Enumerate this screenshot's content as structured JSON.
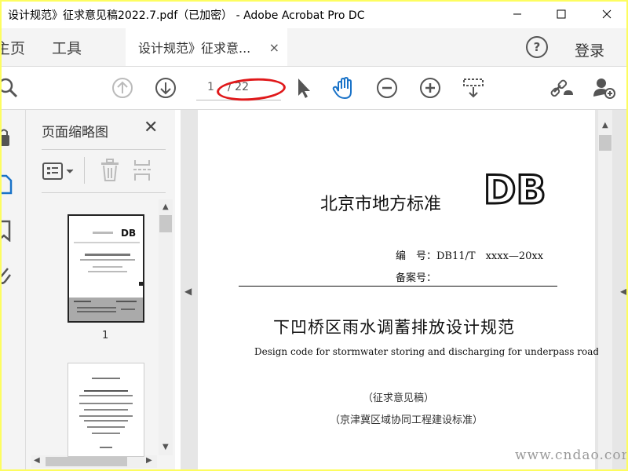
{
  "window": {
    "title": "设计规范》征求意见稿2022.7.pdf（已加密） - Adobe Acrobat Pro DC",
    "controls": [
      "minimize-icon",
      "maximize-icon",
      "close-icon"
    ]
  },
  "tabs": {
    "home": "主页",
    "tools": "工具",
    "document": "设计规范》征求意...",
    "close": "×",
    "help": "?",
    "login": "登录"
  },
  "toolbar": {
    "icons": [
      "search-icon",
      "prev-page-icon",
      "next-page-icon",
      "select-cursor-icon",
      "hand-tool-icon",
      "zoom-out-icon",
      "zoom-in-icon",
      "scroll-mode-icon",
      "share-link-icon",
      "add-user-icon"
    ],
    "page_current": "1",
    "page_total": "/ 22"
  },
  "sidepanel": {
    "title": "页面缩略图",
    "close": "✕",
    "thumb1_number": "1",
    "icons": [
      "thumbnail-options-icon",
      "trash-icon",
      "page-split-icon"
    ]
  },
  "document": {
    "header": "北京市地方标准",
    "logo": "DB",
    "code": "编　号：DB11/T　xxxx—20xx",
    "record": "备案号：",
    "title_cn": "下凹桥区雨水调蓄排放设计规范",
    "title_en": "Design code for stormwater storing and discharging for underpass road",
    "draft": "（征求意见稿）",
    "standard": "（京津冀区域协同工程建设标准）"
  },
  "watermark": "www.cndao.com",
  "colors": {
    "accent": "#1a73c8",
    "highlight": "#e0181a",
    "frame": "#fdfd5f"
  }
}
